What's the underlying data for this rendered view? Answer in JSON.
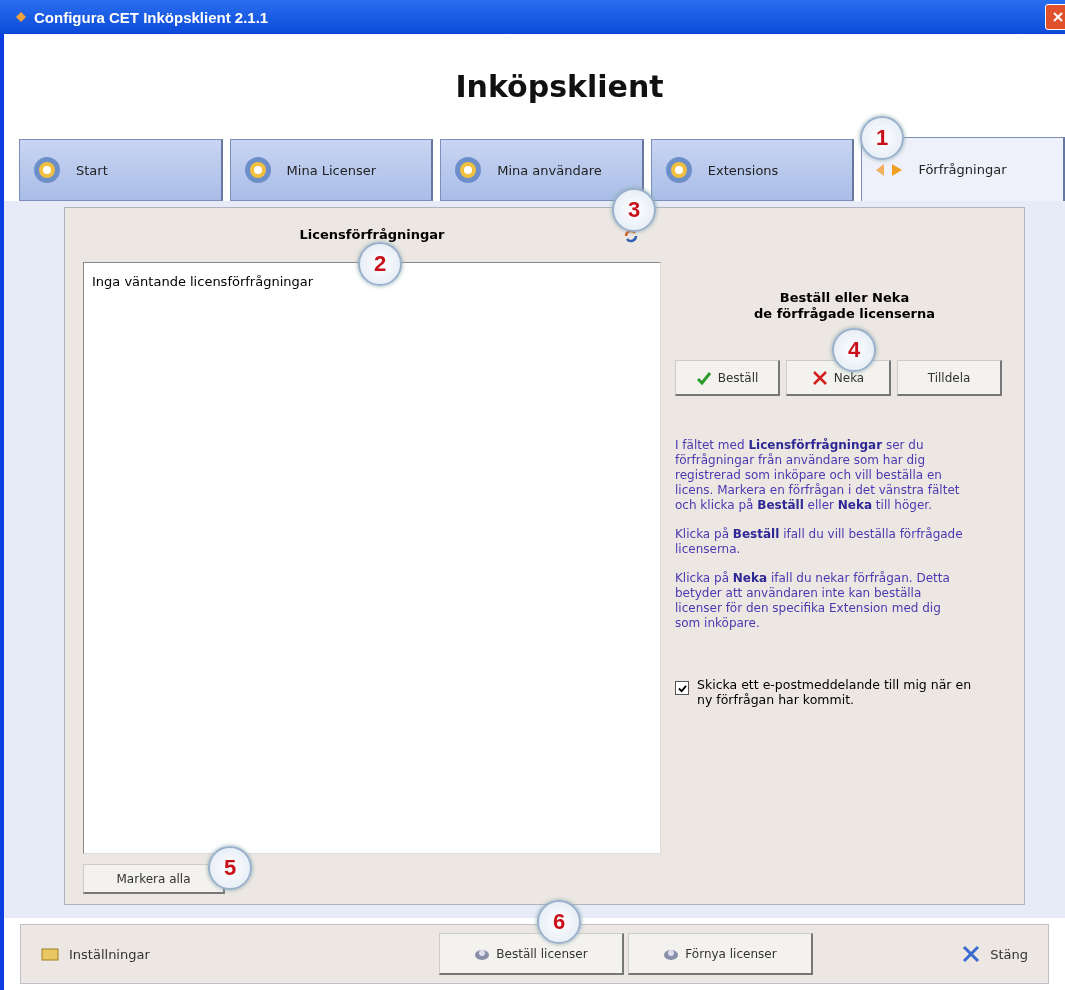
{
  "window": {
    "title": "Configura CET Inköpsklient 2.1.1"
  },
  "heading": "Inköpsklient",
  "tabs": [
    {
      "label": "Start",
      "selected": false
    },
    {
      "label": "Mina Licenser",
      "selected": false
    },
    {
      "label": "Mina användare",
      "selected": false
    },
    {
      "label": "Extensions",
      "selected": false
    },
    {
      "label": "Förfrågningar",
      "selected": true
    }
  ],
  "requests": {
    "title": "Licensförfrågningar",
    "empty_text": "Inga väntande licensförfrågningar",
    "select_all": "Markera alla"
  },
  "actions": {
    "title": "Beställ eller Neka",
    "subtitle": "de förfrågade licenserna",
    "buttons": [
      {
        "label": "Beställ",
        "kind": "approve"
      },
      {
        "label": "Neka",
        "kind": "deny"
      },
      {
        "label": "Tilldela",
        "kind": "plain"
      }
    ],
    "help": [
      "I fältet med **Licensförfrågningar** ser du förfrågningar från användare som har dig registrerad som inköpare och vill beställa en licens. Markera en förfrågan i det vänstra fältet och klicka på **Beställ** eller **Neka** till höger.",
      "Klicka på **Beställ** ifall du vill beställa förfrågade licenserna.",
      "Klicka på **Neka** ifall du nekar förfrågan. Detta betyder att användaren inte kan beställa licenser för den specifika Extension med dig som inköpare."
    ],
    "email_option": {
      "label": "Skicka ett e-postmeddelande till mig när en ny förfrågan har kommit.",
      "checked": true
    }
  },
  "bottom_bar": {
    "settings": "Inställningar",
    "order": "Beställ licenser",
    "renew": "Förnya licenser",
    "close": "Stäng"
  },
  "callouts": [
    "1",
    "2",
    "3",
    "4",
    "5",
    "6"
  ]
}
